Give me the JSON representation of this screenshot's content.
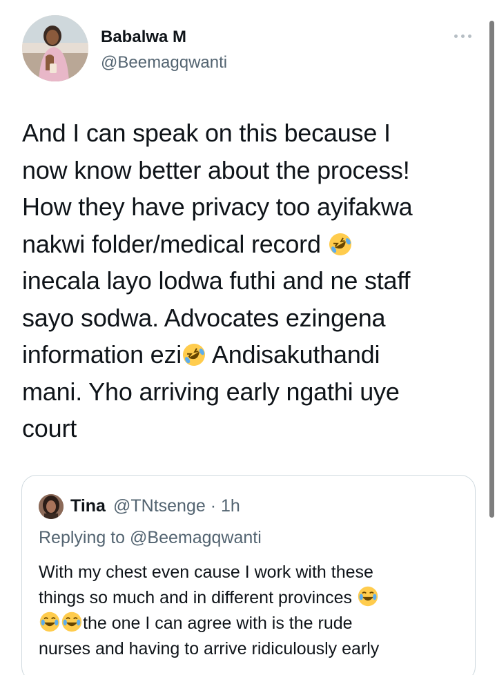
{
  "tweet": {
    "author": {
      "display_name": "Babalwa M",
      "handle": "@Beemagqwanti",
      "avatar": "profile-photo"
    },
    "more_icon": "more-horizontal-icon",
    "text_segments": [
      "And I can speak on this because I",
      "now know better about the process!",
      "How they have privacy too ayifakwa",
      "nakwi folder/medical record ",
      "inecala layo lodwa futhi and ne staff",
      "sayo sodwa. Advocates ezingena",
      "information ezi",
      " Andisakuthandi",
      "mani. Yho arriving early ngathi uye",
      "court"
    ],
    "emojis": {
      "rofl": "rolling-on-floor-laughing-emoji"
    }
  },
  "quote": {
    "author": {
      "display_name": "Tina",
      "handle": "@TNtsenge",
      "separator": " · ",
      "time": "1h"
    },
    "replying_to": "Replying to @Beemagqwanti",
    "text_segments": [
      "With my chest even cause I work with these",
      "things so much and in different provinces ",
      "the one I can agree with is the rude",
      "nurses and having to arrive ridiculously early"
    ],
    "emojis": {
      "joy": "face-with-tears-of-joy-emoji"
    }
  }
}
